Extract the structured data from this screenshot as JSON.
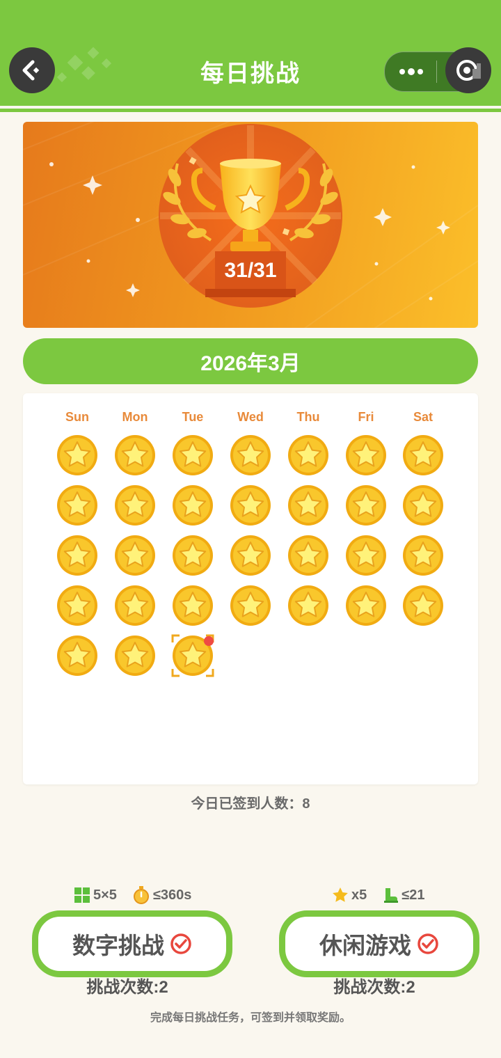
{
  "header": {
    "title": "每日挑战",
    "back_icon": "back-arrow-icon",
    "menu_icon": "more-dots-icon",
    "close_icon": "target-icon",
    "bg_color": "#7cc840"
  },
  "banner": {
    "progress_text": "31/31",
    "trophy_icon": "trophy-icon"
  },
  "calendar": {
    "month_label": "2026年3月",
    "weekdays": [
      "Sun",
      "Mon",
      "Tue",
      "Wed",
      "Thu",
      "Fri",
      "Sat"
    ],
    "days_checked_in": 31,
    "today_index": 30,
    "day_icon": "star-coin-icon"
  },
  "stats": {
    "signed_today": "今日已签到人数：8"
  },
  "challenges": [
    {
      "label": "数字挑战",
      "meta": [
        {
          "icon": "grid-icon",
          "text": "5×5"
        },
        {
          "icon": "timer-icon",
          "text": "≤360s"
        }
      ],
      "count_text": "挑战次数:2",
      "done_icon": "check-circle-icon"
    },
    {
      "label": "休闲游戏",
      "meta": [
        {
          "icon": "star-icon",
          "text": "x5"
        },
        {
          "icon": "boot-icon",
          "text": "≤21"
        }
      ],
      "count_text": "挑战次数:2",
      "done_icon": "check-circle-icon"
    }
  ],
  "footer": {
    "hint": "完成每日挑战任务，可签到并领取奖励。"
  },
  "colors": {
    "accent_green": "#7cc840",
    "coin_gold": "#f5bb1c",
    "weekday_orange": "#e88a3a",
    "check_red": "#e8473d"
  }
}
